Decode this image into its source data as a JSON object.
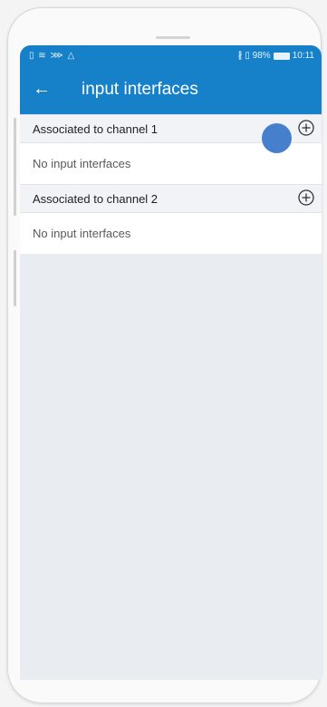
{
  "statusbar": {
    "left_icons": "▯ ≋ ⋙ △",
    "right_text": "∦ ▯ 98%",
    "time": "10:11"
  },
  "appbar": {
    "back_icon": "←",
    "title": "input interfaces"
  },
  "sections": [
    {
      "header": "Associated to channel 1",
      "empty_text": "No input interfaces"
    },
    {
      "header": "Associated to channel 2",
      "empty_text": "No input interfaces"
    }
  ],
  "colors": {
    "primary": "#1680c9",
    "touch_indicator": "#3c78c8"
  },
  "icons": {
    "back": "arrow-left-icon",
    "add": "add-circle-icon",
    "battery": "battery-icon"
  }
}
